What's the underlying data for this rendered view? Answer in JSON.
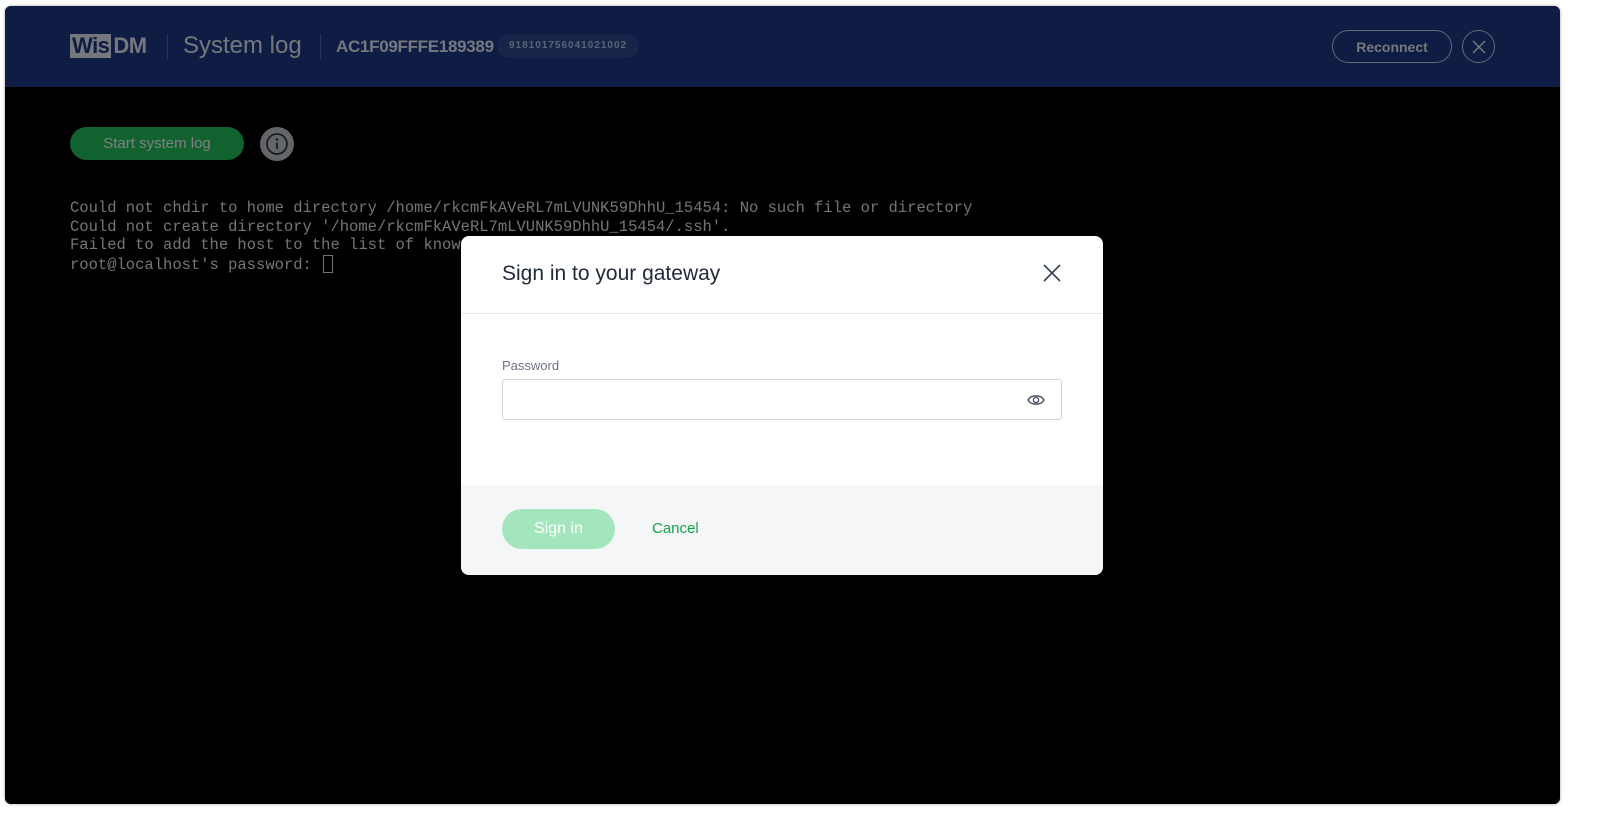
{
  "header": {
    "logo_box": "Wis",
    "logo_rest": "DM",
    "title": "System log",
    "device_id": "AC1F09FFFE189389",
    "serial": "918101756041021002",
    "reconnect_label": "Reconnect",
    "close_icon": "close-icon"
  },
  "toolbar": {
    "start_label": "Start system log",
    "info_icon": "info-icon"
  },
  "terminal": {
    "lines": [
      "Could not chdir to home directory /home/rkcmFkAVeRL7mLVUNK59DhhU_15454: No such file or directory",
      "Could not create directory '/home/rkcmFkAVeRL7mLVUNK59DhhU_15454/.ssh'.",
      "Failed to add the host to the list of known",
      "root@localhost's password: "
    ]
  },
  "modal": {
    "title": "Sign in to your gateway",
    "password_label": "Password",
    "password_value": "",
    "password_placeholder": "",
    "signin_label": "Sign in",
    "cancel_label": "Cancel"
  },
  "colors": {
    "header_bg": "#1e3a8a",
    "accent_green": "#22c55e",
    "signin_disabled": "#a3e6bd",
    "cancel_link": "#16a34a"
  }
}
